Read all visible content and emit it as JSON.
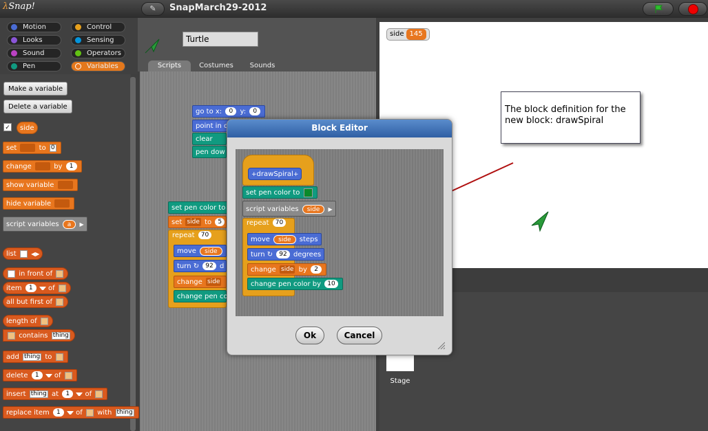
{
  "app": {
    "logo": "Snap!",
    "project_title": "SnapMarch29-2012",
    "file_icon": "pencil-icon"
  },
  "categories": [
    {
      "label": "Motion",
      "color": "#4a6cd4"
    },
    {
      "label": "Control",
      "color": "#e6a01c"
    },
    {
      "label": "Looks",
      "color": "#8a55d7"
    },
    {
      "label": "Sensing",
      "color": "#0494dc"
    },
    {
      "label": "Sound",
      "color": "#bb42c3"
    },
    {
      "label": "Operators",
      "color": "#62c213"
    },
    {
      "label": "Pen",
      "color": "#109a80"
    },
    {
      "label": "Variables",
      "color": "#e8761e"
    }
  ],
  "palette": {
    "make_variable": "Make a variable",
    "delete_variable": "Delete a variable",
    "var_side": "side",
    "set": "set",
    "to": "to",
    "set_value": "0",
    "change": "change",
    "by": "by",
    "change_value": "1",
    "show_variable": "show variable",
    "hide_variable": "hide variable",
    "script_variables": "script variables",
    "script_var_a": "a",
    "list": "list",
    "in_front_of": "in front of",
    "item": "item",
    "of": "of",
    "item_value": "1",
    "all_but_first_of": "all but first of",
    "length_of": "length of",
    "contains": "contains",
    "thing": "thing",
    "add": "add",
    "delete": "delete",
    "insert": "insert",
    "at": "at",
    "replace_item": "replace item",
    "with": "with"
  },
  "sprite": {
    "name": "Turtle"
  },
  "tabs": [
    "Scripts",
    "Costumes",
    "Sounds"
  ],
  "script": {
    "go_to": "go to x:",
    "x": "0",
    "y_label": "y:",
    "y": "0",
    "point_in": "point in d",
    "clear": "clear",
    "pen_down": "pen dow",
    "set_pen_color": "set pen color to",
    "set": "set",
    "set_var": "side",
    "to": "to",
    "set_val": "5",
    "repeat": "repeat",
    "repeat_val": "70",
    "move": "move",
    "move_var": "side",
    "turn": "turn",
    "turn_val": "92",
    "turn_trail": "d",
    "change": "change",
    "change_var": "side",
    "change_pen": "change pen co"
  },
  "stage": {
    "watcher_label": "side",
    "watcher_value": "145",
    "stage_label": "Stage"
  },
  "annotation": {
    "text": "The block definition for the new block: drawSpiral"
  },
  "block_editor": {
    "title": "Block Editor",
    "hat_label": "drawSpiral",
    "set_pen_color": "set pen color to",
    "script_variables": "script variables",
    "script_var": "side",
    "repeat": "repeat",
    "repeat_val": "70",
    "move": "move",
    "move_var": "side",
    "steps": "steps",
    "turn": "turn",
    "turn_val": "92",
    "degrees": "degrees",
    "change": "change",
    "change_var": "side",
    "by": "by",
    "change_val": "2",
    "change_pen": "change pen color by",
    "change_pen_val": "10",
    "ok": "Ok",
    "cancel": "Cancel"
  },
  "colors": {
    "variables": "#e8761e",
    "motion": "#4a6cd4",
    "pen": "#109a80",
    "control": "#e6a01c",
    "lists": "#d95a1e",
    "title_bar": "#3b6db4"
  }
}
